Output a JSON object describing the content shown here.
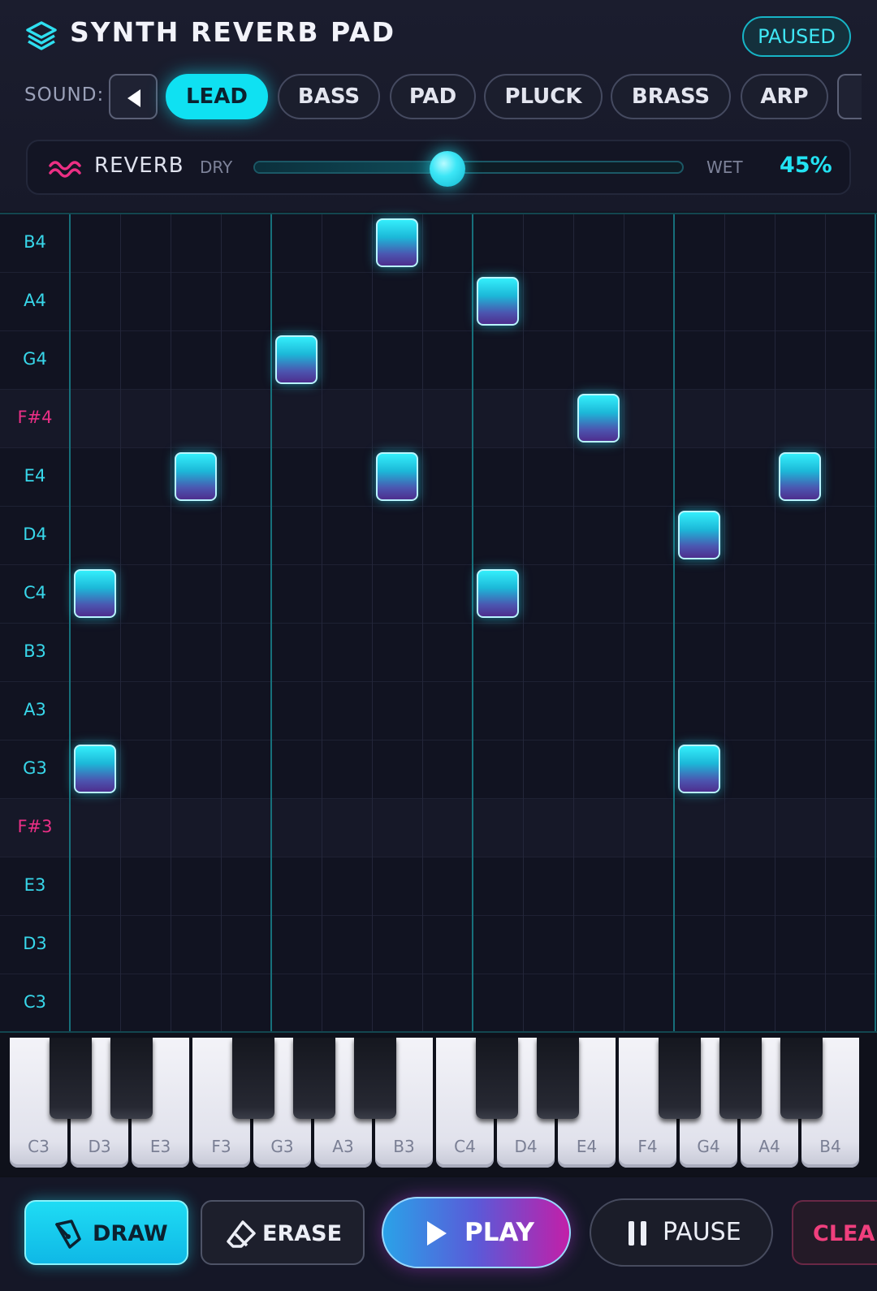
{
  "header": {
    "title": "SYNTH REVERB PAD",
    "status": "PAUSED",
    "logo_icon": "layers-icon"
  },
  "sound": {
    "label": "SOUND:",
    "prev_icon": "caret-left-icon",
    "options": [
      "LEAD",
      "BASS",
      "PAD",
      "PLUCK",
      "BRASS",
      "ARP"
    ],
    "selected": "LEAD"
  },
  "reverb": {
    "icon": "wave-icon",
    "label": "REVERB",
    "dry_label": "DRY",
    "wet_label": "WET",
    "value_text": "45%",
    "value": 45
  },
  "grid": {
    "rows": [
      "B4",
      "A4",
      "G4",
      "F#4",
      "E4",
      "D4",
      "C4",
      "B3",
      "A3",
      "G3",
      "F#3",
      "E3",
      "D3",
      "C3"
    ],
    "steps": 16,
    "beat_every": 4,
    "notes": [
      {
        "pitch": "B4",
        "step": 6
      },
      {
        "pitch": "A4",
        "step": 8
      },
      {
        "pitch": "G4",
        "step": 4
      },
      {
        "pitch": "F#4",
        "step": 10
      },
      {
        "pitch": "E4",
        "step": 2
      },
      {
        "pitch": "E4",
        "step": 6
      },
      {
        "pitch": "E4",
        "step": 14
      },
      {
        "pitch": "D4",
        "step": 12
      },
      {
        "pitch": "C4",
        "step": 0
      },
      {
        "pitch": "C4",
        "step": 8
      },
      {
        "pitch": "G3",
        "step": 0
      },
      {
        "pitch": "G3",
        "step": 12
      }
    ]
  },
  "keyboard": {
    "white_keys": [
      "C3",
      "D3",
      "E3",
      "F3",
      "G3",
      "A3",
      "B3",
      "C4",
      "D4",
      "E4",
      "F4",
      "G4",
      "A4",
      "B4"
    ],
    "black_keys": [
      "C#3",
      "D#3",
      "F#3",
      "G#3",
      "A#3",
      "C#4",
      "D#4",
      "F#4",
      "G#4",
      "A#4"
    ]
  },
  "toolbar": {
    "draw_label": "DRAW",
    "draw_icon": "pen-icon",
    "erase_label": "ERASE",
    "erase_icon": "eraser-icon",
    "play_label": "PLAY",
    "play_icon": "play-icon",
    "pause_label": "PAUSE",
    "pause_icon": "pause-icon",
    "clear_label": "CLEA"
  },
  "colors": {
    "accent": "#12e0f2",
    "sharp_row": "#ea2f86",
    "clear": "#ef3f7d",
    "background": "#111321"
  }
}
